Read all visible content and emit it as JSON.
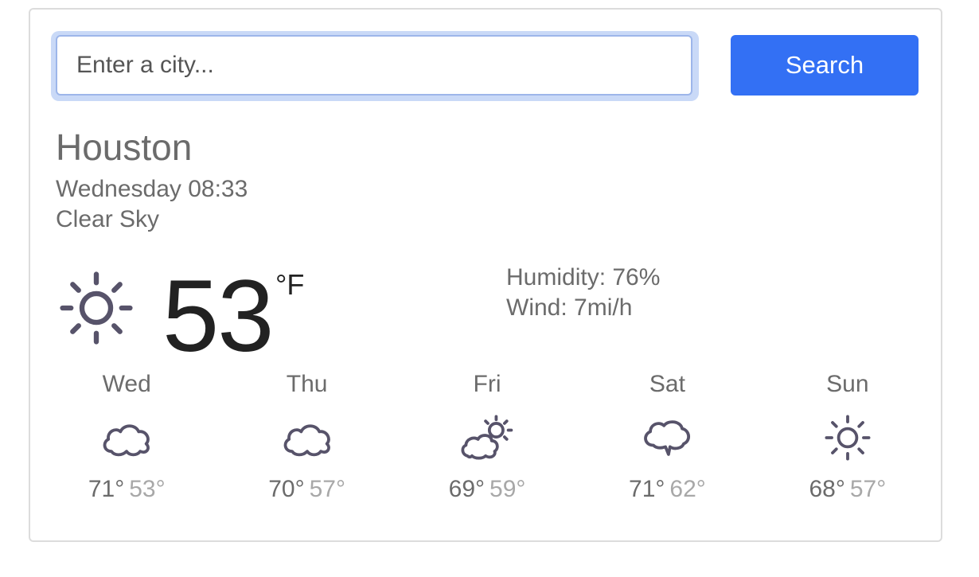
{
  "search": {
    "placeholder": "Enter a city...",
    "button_label": "Search"
  },
  "current": {
    "city": "Houston",
    "datetime": "Wednesday 08:33",
    "condition": "Clear Sky",
    "temperature": "53",
    "unit": "°F",
    "icon": "sun-icon",
    "humidity_label": "Humidity: 76%",
    "wind_label": "Wind: 7mi/h"
  },
  "forecast": [
    {
      "day": "Wed",
      "high": "71°",
      "low": "53°",
      "icon": "cloud-icon"
    },
    {
      "day": "Thu",
      "high": "70°",
      "low": "57°",
      "icon": "cloud-icon"
    },
    {
      "day": "Fri",
      "high": "69°",
      "low": "59°",
      "icon": "partly-cloudy-icon"
    },
    {
      "day": "Sat",
      "high": "71°",
      "low": "62°",
      "icon": "cloud-speech-icon"
    },
    {
      "day": "Sun",
      "high": "68°",
      "low": "57°",
      "icon": "sun-icon"
    }
  ],
  "colors": {
    "accent": "#3370f4",
    "icon": "#57536a",
    "text": "#6b6b6b"
  }
}
